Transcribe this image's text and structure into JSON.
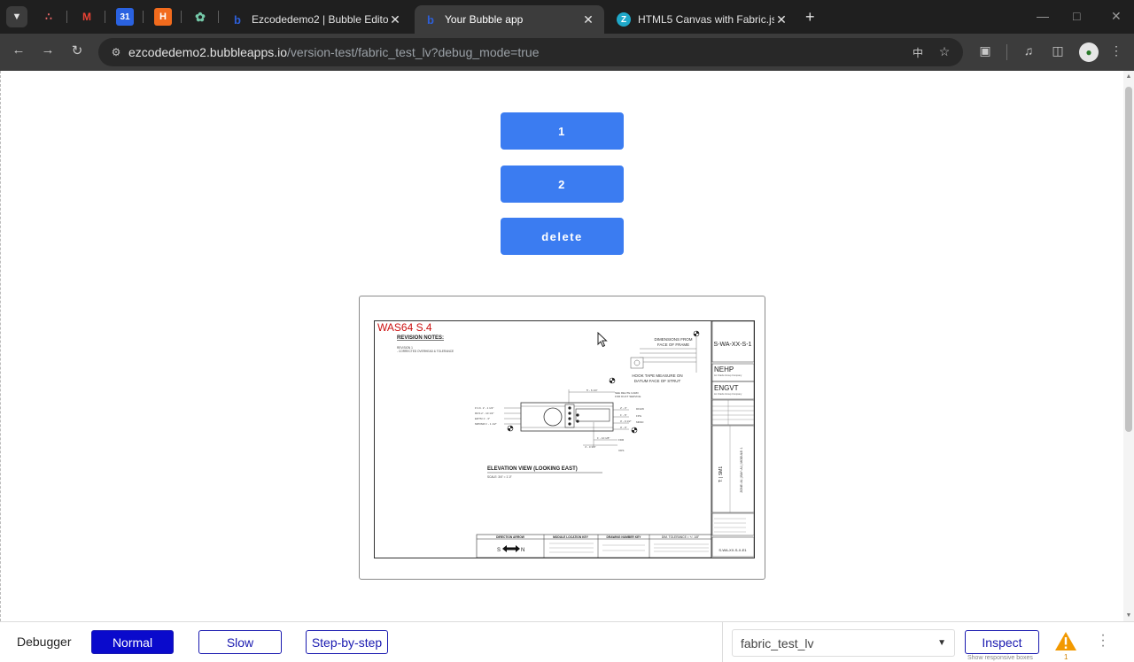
{
  "browser": {
    "tabs": [
      {
        "title": "Ezcodedemo2 | Bubble Editor",
        "active": false
      },
      {
        "title": "Your Bubble app",
        "active": true
      },
      {
        "title": "HTML5 Canvas with Fabric.js Plu",
        "active": false
      }
    ],
    "new_tab": "+",
    "url_host": "ezcodedemo2.bubbleapps.io",
    "url_path": "/version-test/fabric_test_lv?debug_mode=true"
  },
  "page": {
    "buttons": [
      "1",
      "2",
      "delete"
    ]
  },
  "drawing": {
    "title": "WAS64 S.4",
    "revision_notes": "REVISION NOTES:",
    "revision_line1": "REVISION 1",
    "revision_line2": "- CORRECTED OVERHEAD & TOLERANCE",
    "dimensions_note_1": "DIMENSIONS FROM",
    "dimensions_note_2": "FACE OF FRAME",
    "hook_note_1": "HOOK TAPE MEASURE ON",
    "hook_note_2": "DATUM FACE OF STRUT",
    "elevation_title": "ELEVATION VIEW (LOOKING EAST)",
    "elevation_scale": "SCALE: 3/4\" = 1'-0\"",
    "direction_arrow_label": "DIRECTION ARROW",
    "direction_s": "S",
    "direction_n": "N",
    "module_key_label": "MODULE LOCATION KEY",
    "drawing_number_key_label": "DRAWING NUMBER KEY",
    "tolerance_label": "DIM. TOLERANCE = +/- 1/8\"",
    "sheet_id": "S-WA-XX-S-1",
    "nehp": "NEHP",
    "engvt": "ENGVT",
    "sub_company": "An Oracle Group Company",
    "drawing_no_bottom": "S-WA-XX-S-X-E1"
  },
  "debugger": {
    "label": "Debugger",
    "modes": [
      "Normal",
      "Slow",
      "Step-by-step"
    ],
    "active_mode": "Normal",
    "page_select": "fabric_test_lv",
    "inspect": "Inspect",
    "show_boxes": "Show responsive boxes",
    "warning_count": "1"
  },
  "colors": {
    "bubble_button": "#3b7cf1",
    "debugger_active": "#0a0acc",
    "drawing_title": "#cc1111",
    "warning": "#f29900"
  },
  "icons": {
    "tab_menu": "chevron-down-icon",
    "back": "arrow-left-icon",
    "forward": "arrow-right-icon",
    "reload": "reload-icon",
    "site_info": "tune-icon",
    "translate": "translate-icon",
    "bookmark": "star-icon",
    "extensions": "puzzle-icon",
    "media": "media-control-icon",
    "sidepanel": "side-panel-icon",
    "warning": "warning-icon"
  }
}
